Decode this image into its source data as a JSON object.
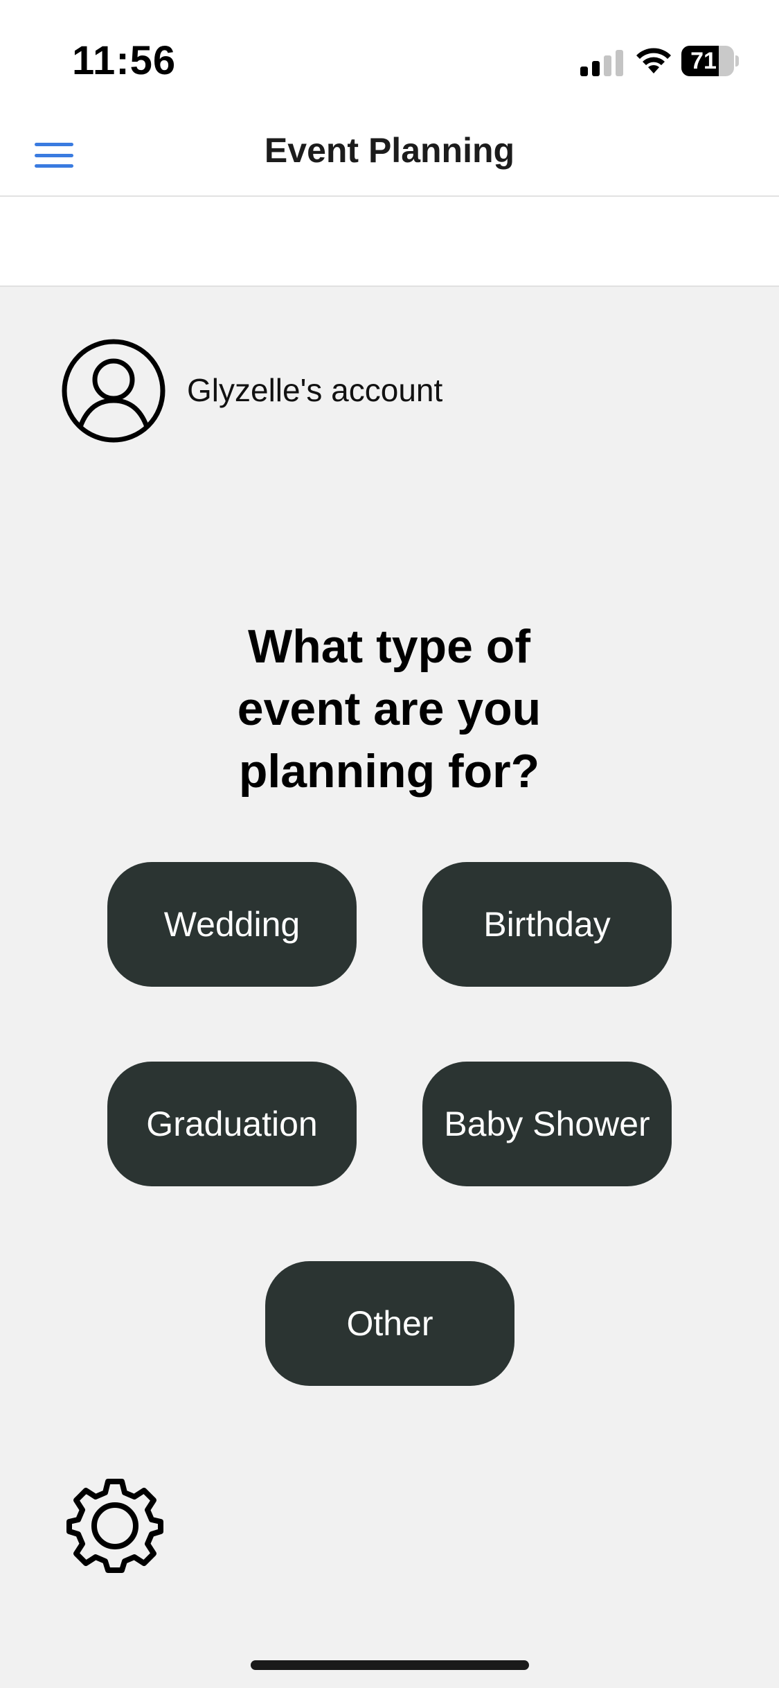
{
  "status_bar": {
    "time": "11:56",
    "battery_level": "71",
    "battery_percent": 71
  },
  "nav": {
    "title": "Event Planning"
  },
  "account": {
    "label": "Glyzelle's account"
  },
  "main": {
    "question": "What type of event are you planning for?",
    "options": [
      "Wedding",
      "Birthday",
      "Graduation",
      "Baby Shower",
      "Other"
    ]
  },
  "colors": {
    "accent": "#3a7be0",
    "button_bg": "#2b3432",
    "page_bg": "#f1f1f1"
  },
  "icons": {
    "menu": "menu-icon",
    "avatar": "account-circle-icon",
    "settings": "gear-icon"
  }
}
